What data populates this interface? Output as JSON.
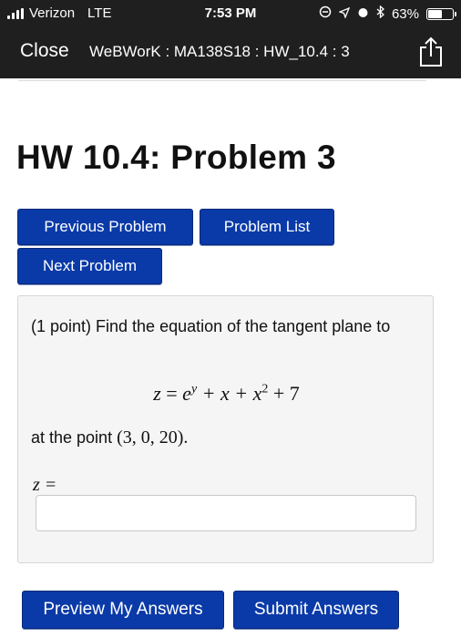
{
  "status_bar": {
    "carrier": "Verizon",
    "network": "LTE",
    "time": "7:53 PM",
    "battery_percent": "63%",
    "battery_level": 0.63
  },
  "nav": {
    "close_label": "Close",
    "title": "WeBWorK : MA138S18 : HW_10.4 : 3"
  },
  "page": {
    "title": "HW 10.4: Problem 3"
  },
  "buttons": {
    "previous": "Previous Problem",
    "list": "Problem List",
    "next": "Next Problem",
    "preview": "Preview My Answers",
    "submit": "Submit Answers"
  },
  "problem": {
    "statement": "(1 point) Find the equation of the tangent plane to",
    "equation_lhs": "z",
    "equation_rhs_base": "e",
    "equation_rhs_exp": "y",
    "equation_rest": " + x + x",
    "equation_sq": "2",
    "equation_const": " + 7",
    "point_prefix": "at the point ",
    "point": "(3, 0, 20).",
    "answer_label": "z =",
    "answer_value": ""
  },
  "colors": {
    "button_bg": "#0a3aa8",
    "bar_bg": "#1f1f1f"
  }
}
